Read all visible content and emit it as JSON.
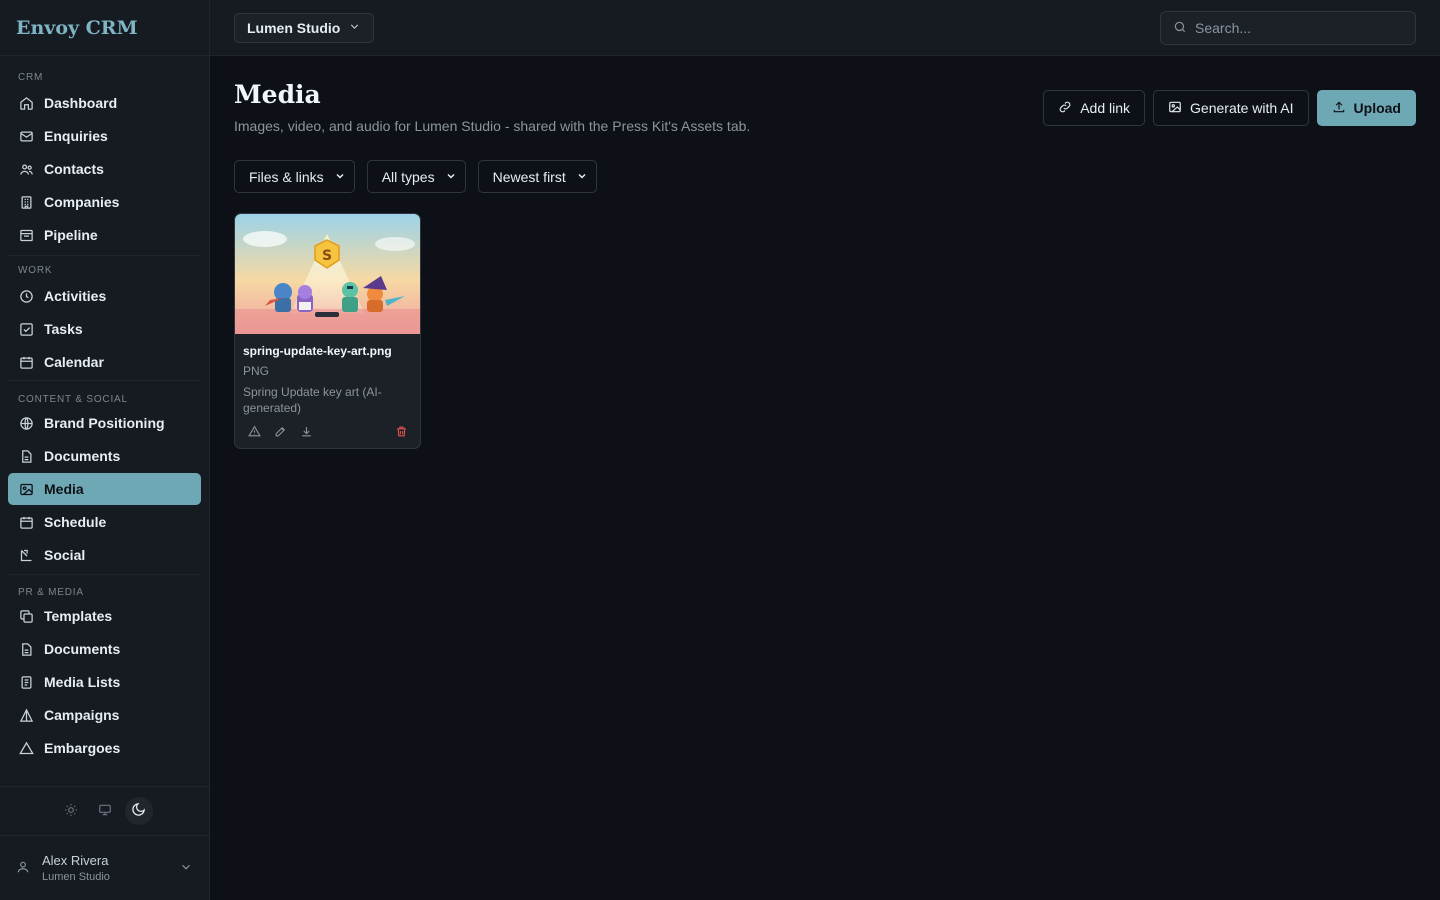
{
  "app": {
    "brand": "Envoy CRM"
  },
  "sidebar": {
    "sections": [
      {
        "label": "CRM",
        "items": [
          {
            "label": "Dashboard",
            "icon": "home-icon"
          },
          {
            "label": "Enquiries",
            "icon": "mail-icon"
          },
          {
            "label": "Contacts",
            "icon": "users-icon"
          },
          {
            "label": "Companies",
            "icon": "building-icon"
          },
          {
            "label": "Pipeline",
            "icon": "kanban-icon"
          }
        ]
      },
      {
        "label": "WORK",
        "items": [
          {
            "label": "Activities",
            "icon": "clock-icon"
          },
          {
            "label": "Tasks",
            "icon": "checkbox-icon"
          },
          {
            "label": "Calendar",
            "icon": "calendar-icon"
          }
        ]
      },
      {
        "label": "CONTENT & SOCIAL",
        "items": [
          {
            "label": "Brand Positioning",
            "icon": "globe-icon"
          },
          {
            "label": "Documents",
            "icon": "file-icon"
          },
          {
            "label": "Media",
            "icon": "image-icon",
            "active": true
          },
          {
            "label": "Schedule",
            "icon": "calendar-icon"
          },
          {
            "label": "Social",
            "icon": "share-icon"
          }
        ]
      },
      {
        "label": "PR & MEDIA",
        "items": [
          {
            "label": "Templates",
            "icon": "copy-icon"
          },
          {
            "label": "Documents",
            "icon": "file-icon"
          },
          {
            "label": "Media Lists",
            "icon": "list-icon"
          },
          {
            "label": "Campaigns",
            "icon": "triangle-icon"
          },
          {
            "label": "Embargoes",
            "icon": "alert-icon"
          }
        ]
      }
    ],
    "user": {
      "name": "Alex Rivera",
      "org": "Lumen Studio"
    }
  },
  "topbar": {
    "workspace": "Lumen Studio",
    "search_placeholder": "Search..."
  },
  "page": {
    "title": "Media",
    "subtitle": "Images, video, and audio for Lumen Studio - shared with the Press Kit's Assets tab.",
    "actions": {
      "add_link": "Add link",
      "generate": "Generate with AI",
      "upload": "Upload"
    },
    "filters": {
      "scope": "Files & links",
      "type": "All types",
      "sort": "Newest first"
    }
  },
  "media_items": [
    {
      "file_name": "spring-update-key-art.png",
      "file_type": "PNG",
      "description": "Spring Update key art (AI-generated)"
    }
  ],
  "colors": {
    "accent": "#6fa8b5",
    "brand_text": "#7fb4c2",
    "danger": "#e5534b",
    "background": "#0d1117",
    "panel": "#161b22"
  }
}
